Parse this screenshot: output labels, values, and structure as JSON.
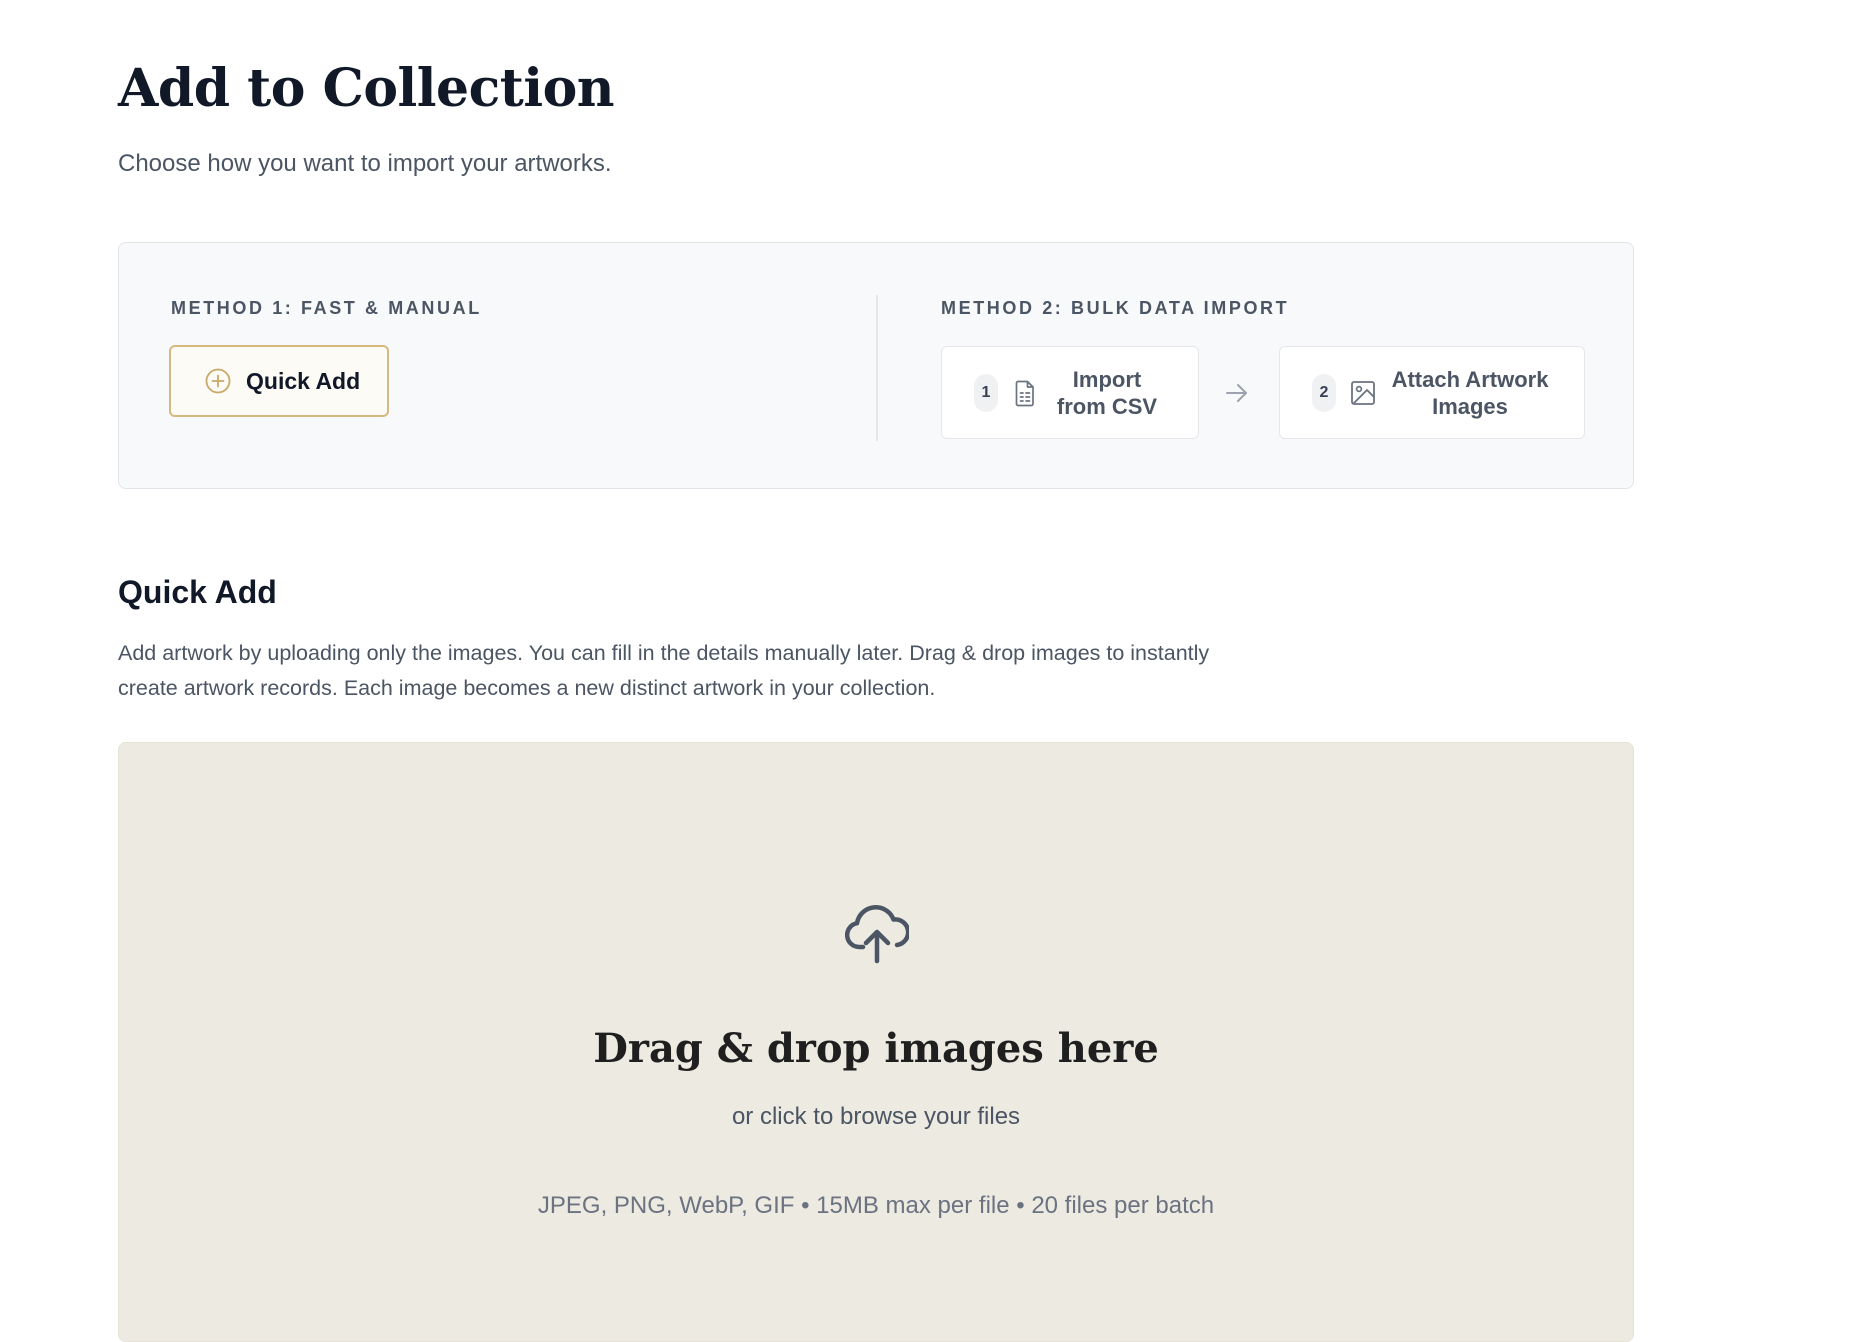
{
  "header": {
    "title": "Add to Collection",
    "subtitle": "Choose how you want to import your artworks."
  },
  "methods": {
    "method1": {
      "label": "METHOD 1: FAST & MANUAL",
      "button_label": "Quick Add",
      "button_icon": "plus-circle-icon"
    },
    "method2": {
      "label": "METHOD 2: BULK DATA IMPORT",
      "steps": [
        {
          "number": "1",
          "icon": "file-icon",
          "label": "Import from CSV"
        },
        {
          "number": "2",
          "icon": "image-icon",
          "label": "Attach Artwork Images"
        }
      ],
      "arrow_icon": "arrow-right-icon"
    }
  },
  "quick_add": {
    "title": "Quick Add",
    "description": "Add artwork by uploading only the images. You can fill in the details manually later. Drag & drop images to instantly create artwork records. Each image becomes a new distinct artwork in your collection."
  },
  "dropzone": {
    "icon": "cloud-upload-icon",
    "title": "Drag & drop images here",
    "subtitle": "or click to browse your files",
    "hint": "JPEG, PNG, WebP, GIF • 15MB max per file • 20 files per batch"
  },
  "colors": {
    "accent": "#d6b97f",
    "dropzone_bg": "#edeae2",
    "card_bg": "#f8f9fa",
    "text_primary": "#111827",
    "text_secondary": "#4b5563"
  }
}
